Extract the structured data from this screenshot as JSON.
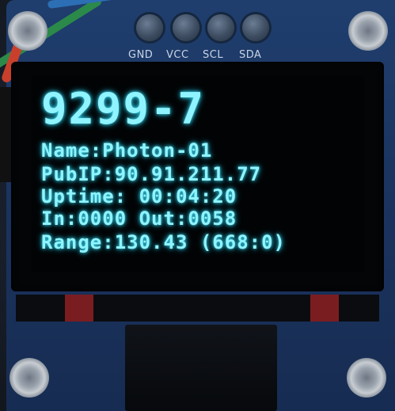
{
  "board": {
    "pins": [
      "GND",
      "VCC",
      "SCL",
      "SDA"
    ]
  },
  "display": {
    "device_id": "9299-7",
    "lines": [
      "Name:Photon-01",
      "PubIP:90.91.211.77",
      "Uptime: 00:04:20",
      "In:0000 Out:0058",
      "Range:130.43 (668:0)"
    ],
    "text_color": "#8ff4ff"
  },
  "colors": {
    "pcb": "#1f3e6e",
    "screen": "#030507"
  }
}
